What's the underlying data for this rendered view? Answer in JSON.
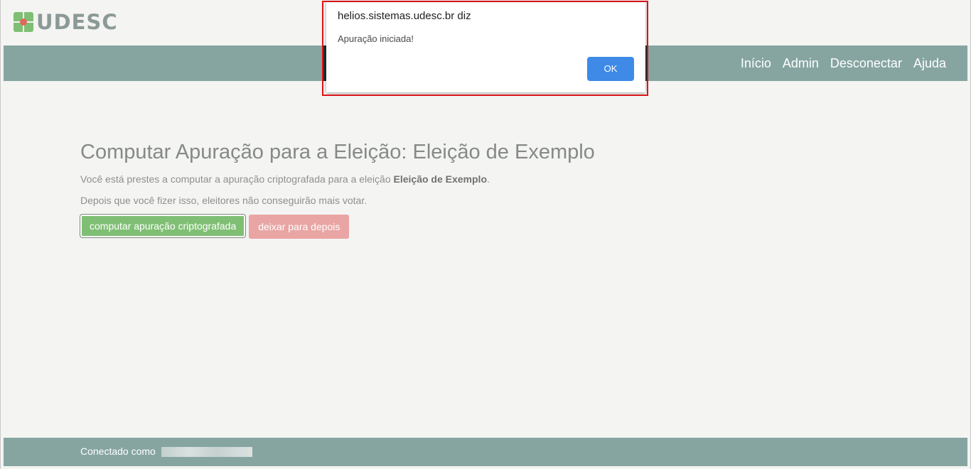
{
  "header": {
    "logo_text": "UDESC"
  },
  "nav": {
    "items": [
      {
        "label": "Início"
      },
      {
        "label": "Admin"
      },
      {
        "label": "Desconectar"
      },
      {
        "label": "Ajuda"
      }
    ]
  },
  "main": {
    "title": "Computar Apuração para a Eleição: Eleição de Exemplo",
    "description_prefix": "Você está prestes a computar a apuração criptografada para a eleição ",
    "election_name": "Eleição de Exemplo",
    "description_suffix": ".",
    "warning": "Depois que você fizer isso, eleitores não conseguirão mais votar.",
    "compute_button": "computar apuração criptografada",
    "later_button": "deixar para depois"
  },
  "footer": {
    "connected_label": "Conectado como"
  },
  "dialog": {
    "title": "helios.sistemas.udesc.br diz",
    "message": "Apuração iniciada!",
    "ok_label": "OK"
  },
  "colors": {
    "navbar": "#86a5a1",
    "compute_button": "#7fbf74",
    "later_button": "#e9a5a4",
    "dialog_ok": "#3e8ae6",
    "highlight_outline": "#e0141a"
  }
}
